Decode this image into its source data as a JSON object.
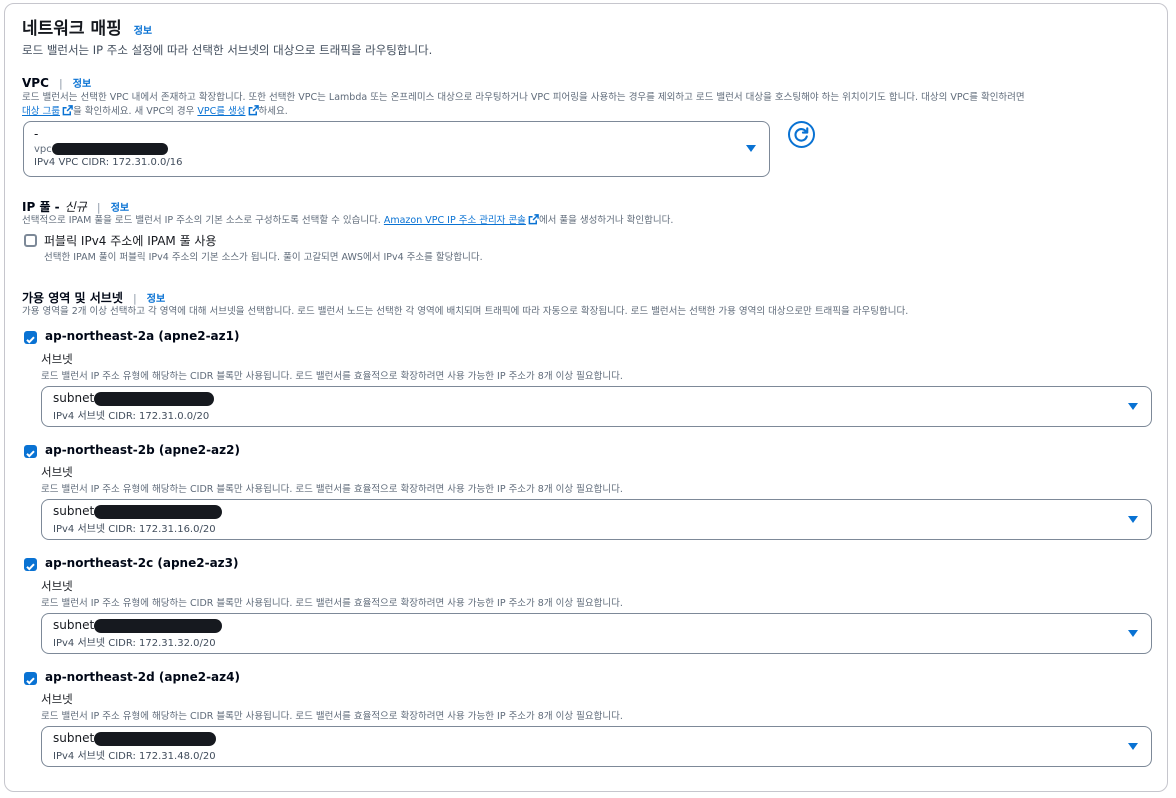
{
  "section": {
    "title": "네트워크 매핑",
    "info_label": "정보",
    "description": "로드 밸런서는 IP 주소 설정에 따라 선택한 서브넷의 대상으로 트래픽을 라우팅합니다."
  },
  "vpc": {
    "label": "VPC",
    "info_label": "정보",
    "description_line1": "로드 밸런서는 선택한 VPC 내에서 존재하고 확장합니다. 또한 선택한 VPC는 Lambda 또는 온프레미스 대상으로 라우팅하거나 VPC 피어링을 사용하는 경우를 제외하고 로드 밸런서 대상을 호스팅해야 하는 위치이기도 합니다. 대상의 VPC를 확인하려면",
    "target_group_link": "대상 그룹",
    "desc_mid": "을 확인하세요. 새 VPC의 경우",
    "create_vpc_link": "VPC를 생성",
    "desc_end": "하세요.",
    "selected_name": "-",
    "selected_id_prefix": "vpc",
    "selected_cidr": "IPv4 VPC CIDR: 172.31.0.0/16"
  },
  "ip_pool": {
    "label": "IP 풀 -",
    "label_new": "신규",
    "info_label": "정보",
    "description_pre": "선택적으로 IPAM 풀을 로드 밸런서 IP 주소의 기본 소스로 구성하도록 선택할 수 있습니다.",
    "ipam_link": "Amazon VPC IP 주소 관리자 콘솔",
    "description_post": "에서 풀을 생성하거나 확인합니다.",
    "checkbox_label": "퍼블릭 IPv4 주소에 IPAM 풀 사용",
    "checkbox_checked": false,
    "checkbox_help": "선택한 IPAM 풀이 퍼블릭 IPv4 주소의 기본 소스가 됩니다. 풀이 고갈되면 AWS에서 IPv4 주소를 할당합니다."
  },
  "az": {
    "label": "가용 영역 및 서브넷",
    "info_label": "정보",
    "description": "가용 영역을 2개 이상 선택하고 각 영역에 대해 서브넷을 선택합니다. 로드 밸런서 노드는 선택한 각 영역에 배치되며 트래픽에 따라 자동으로 확장됩니다. 로드 밸런서는 선택한 가용 영역의 대상으로만 트래픽을 라우팅합니다.",
    "zones": [
      {
        "name": "ap-northeast-2a (apne2-az1)",
        "checked": true,
        "subnet_label": "서브넷",
        "subnet_help": "로드 밸런서 IP 주소 유형에 해당하는 CIDR 블록만 사용됩니다. 로드 밸런서를 효율적으로 확장하려면 사용 가능한 IP 주소가 8개 이상 필요합니다.",
        "subnet_prefix": "subnet",
        "subnet_cidr": "IPv4 서브넷 CIDR: 172.31.0.0/20"
      },
      {
        "name": "ap-northeast-2b (apne2-az2)",
        "checked": true,
        "subnet_label": "서브넷",
        "subnet_help": "로드 밸런서 IP 주소 유형에 해당하는 CIDR 블록만 사용됩니다. 로드 밸런서를 효율적으로 확장하려면 사용 가능한 IP 주소가 8개 이상 필요합니다.",
        "subnet_prefix": "subnet",
        "subnet_cidr": "IPv4 서브넷 CIDR: 172.31.16.0/20"
      },
      {
        "name": "ap-northeast-2c (apne2-az3)",
        "checked": true,
        "subnet_label": "서브넷",
        "subnet_help": "로드 밸런서 IP 주소 유형에 해당하는 CIDR 블록만 사용됩니다. 로드 밸런서를 효율적으로 확장하려면 사용 가능한 IP 주소가 8개 이상 필요합니다.",
        "subnet_prefix": "subnet",
        "subnet_cidr": "IPv4 서브넷 CIDR: 172.31.32.0/20"
      },
      {
        "name": "ap-northeast-2d (apne2-az4)",
        "checked": true,
        "subnet_label": "서브넷",
        "subnet_help": "로드 밸런서 IP 주소 유형에 해당하는 CIDR 블록만 사용됩니다. 로드 밸런서를 효율적으로 확장하려면 사용 가능한 IP 주소가 8개 이상 필요합니다.",
        "subnet_prefix": "subnet",
        "subnet_cidr": "IPv4 서브넷 CIDR: 172.31.48.0/20"
      }
    ]
  },
  "icons": {
    "external_link": "external-link-icon",
    "refresh": "refresh-icon",
    "caret": "caret-down-icon",
    "checkbox": "checkbox-icon"
  },
  "colors": {
    "accent": "#0972d3",
    "text": "#16191f",
    "muted": "#414d5c",
    "border": "#7d8998"
  }
}
